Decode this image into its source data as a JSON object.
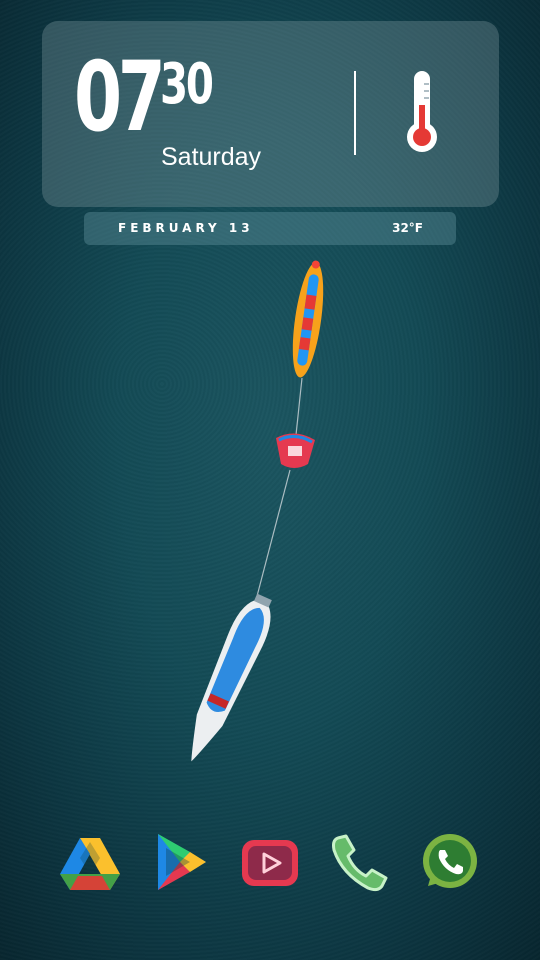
{
  "clock": {
    "hour": "07",
    "minute": "30",
    "weekday": "Saturday",
    "thermometer_icon": "thermometer-icon"
  },
  "date_bar": {
    "date": "FEBRUARY 13",
    "temperature": "32°F"
  },
  "dock": {
    "apps": [
      {
        "name": "Google Drive",
        "icon": "google-drive-icon"
      },
      {
        "name": "Google Play Store",
        "icon": "play-store-icon"
      },
      {
        "name": "YouTube",
        "icon": "youtube-icon"
      },
      {
        "name": "Phone",
        "icon": "phone-icon"
      },
      {
        "name": "WhatsApp",
        "icon": "whatsapp-icon"
      }
    ]
  },
  "colors": {
    "background": "#134a55",
    "widget": "#8a9ea2",
    "accent_red": "#e53935"
  }
}
